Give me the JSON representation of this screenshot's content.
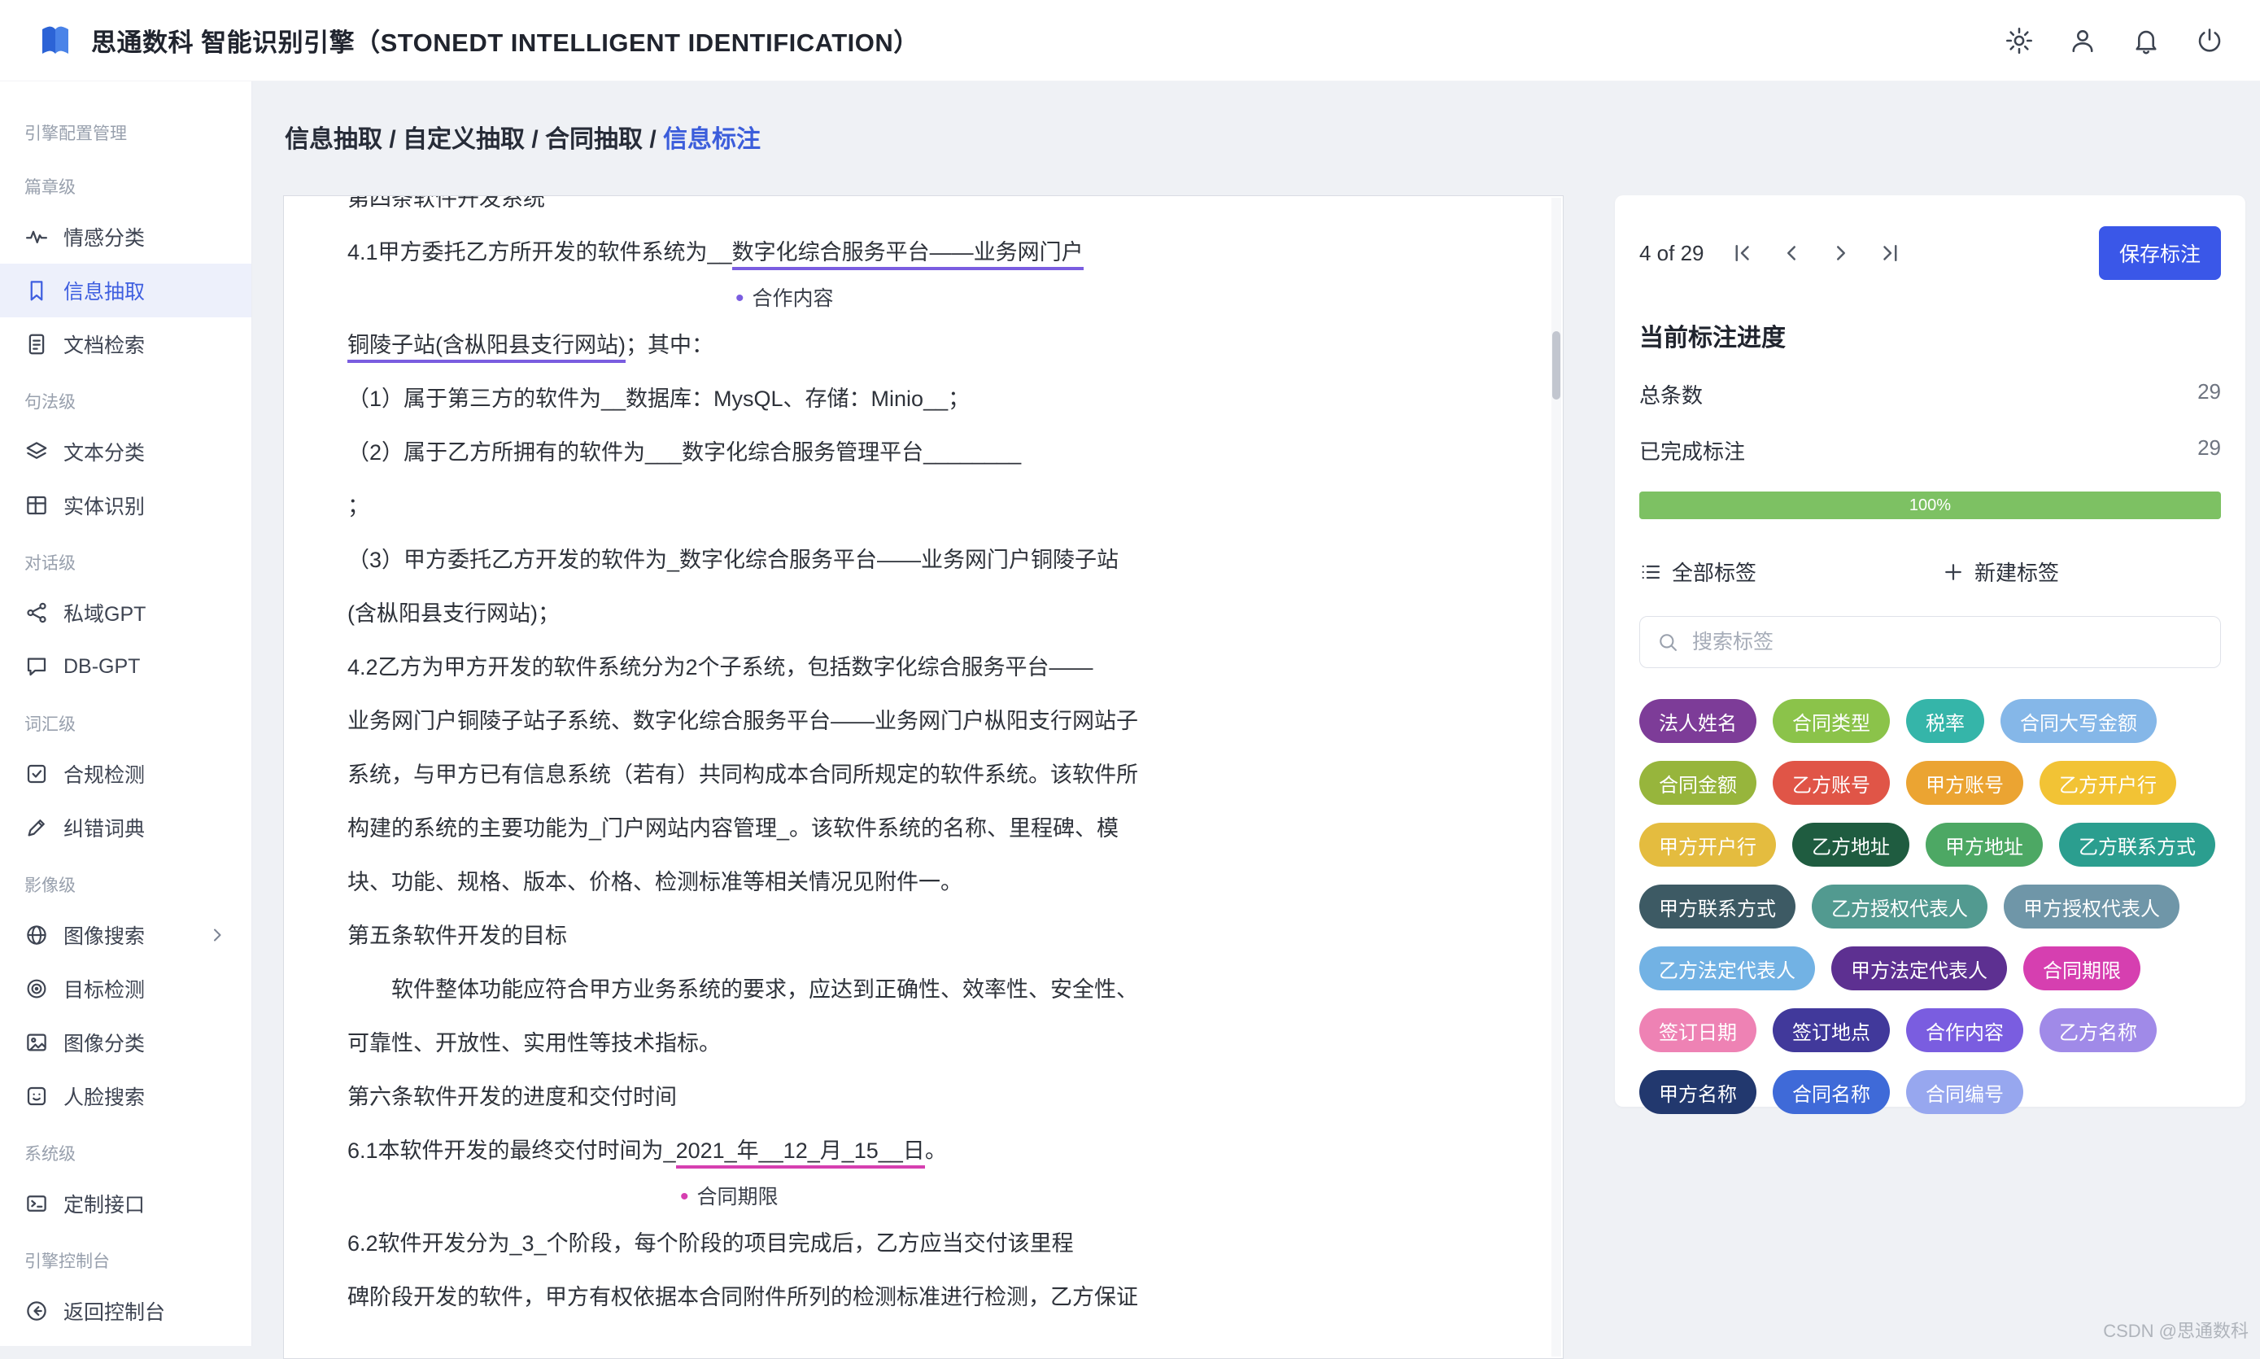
{
  "header": {
    "title": "思通数科 智能识别引擎（STONEDT INTELLIGENT IDENTIFICATION）",
    "icons": [
      {
        "id": "gear",
        "name": "gear-icon"
      },
      {
        "id": "user",
        "name": "user-icon"
      },
      {
        "id": "bell",
        "name": "bell-icon"
      },
      {
        "id": "power",
        "name": "power-icon"
      }
    ]
  },
  "sidebar": {
    "sections": [
      {
        "label": "引擎配置管理",
        "items": []
      },
      {
        "label": "篇章级",
        "items": [
          {
            "id": "sentiment",
            "label": "情感分类",
            "icon": "pulse"
          },
          {
            "id": "info-extract",
            "label": "信息抽取",
            "icon": "bookmark",
            "active": true
          },
          {
            "id": "doc-search",
            "label": "文档检索",
            "icon": "doc"
          }
        ]
      },
      {
        "label": "句法级",
        "items": [
          {
            "id": "text-classify",
            "label": "文本分类",
            "icon": "layers"
          },
          {
            "id": "entity-recognition",
            "label": "实体识别",
            "icon": "grid"
          }
        ]
      },
      {
        "label": "对话级",
        "items": [
          {
            "id": "private-gpt",
            "label": "私域GPT",
            "icon": "network"
          },
          {
            "id": "db-gpt",
            "label": "DB-GPT",
            "icon": "chat"
          }
        ]
      },
      {
        "label": "词汇级",
        "items": [
          {
            "id": "compliance-check",
            "label": "合规检测",
            "icon": "checkbox"
          },
          {
            "id": "correction-dict",
            "label": "纠错词典",
            "icon": "pencil"
          }
        ]
      },
      {
        "label": "影像级",
        "items": [
          {
            "id": "image-search",
            "label": "图像搜索",
            "icon": "globe",
            "chevron": true
          },
          {
            "id": "object-detection",
            "label": "目标检测",
            "icon": "target"
          },
          {
            "id": "image-classify",
            "label": "图像分类",
            "icon": "image"
          },
          {
            "id": "face-search",
            "label": "人脸搜索",
            "icon": "face"
          }
        ]
      },
      {
        "label": "系统级",
        "items": [
          {
            "id": "custom-api",
            "label": "定制接口",
            "icon": "api"
          }
        ]
      },
      {
        "label": "引擎控制台",
        "items": [
          {
            "id": "back-console",
            "label": "返回控制台",
            "icon": "back"
          }
        ]
      }
    ]
  },
  "breadcrumb": {
    "items": [
      "信息抽取",
      "自定义抽取",
      "合同抽取"
    ],
    "current": "信息标注",
    "separator": "/"
  },
  "document": {
    "marks": {
      "coop": {
        "label": "合作内容",
        "color": "#7a5de0"
      },
      "term": {
        "label": "合同期限",
        "color": "#d63fb0"
      }
    },
    "lines": [
      {
        "type": "clipped",
        "segs": [
          {
            "t": "第四条软件开发系统"
          }
        ]
      },
      {
        "type": "text",
        "segs": [
          {
            "t": "4.1甲方委托乙方所开发的软件系统为__"
          },
          {
            "t": "数字化综合服务平台——业务网门户",
            "mark": "coop"
          }
        ]
      },
      {
        "type": "label",
        "mark": "coop",
        "indent": 477
      },
      {
        "type": "text",
        "segs": [
          {
            "t": "铜陵子站(含枞阳县支行网站)",
            "mark": "coop"
          },
          {
            "t": "；其中："
          }
        ]
      },
      {
        "type": "text",
        "segs": [
          {
            "t": "（1）属于第三方的软件为__数据库：MysQL、存储：Minio__；"
          }
        ]
      },
      {
        "type": "text",
        "segs": [
          {
            "t": "（2）属于乙方所拥有的软件为___数字化综合服务管理平台________"
          }
        ]
      },
      {
        "type": "text",
        "segs": [
          {
            "t": "；"
          }
        ]
      },
      {
        "type": "text",
        "segs": [
          {
            "t": "（3）甲方委托乙方开发的软件为_数字化综合服务平台——业务网门户铜陵子站"
          }
        ]
      },
      {
        "type": "text",
        "segs": [
          {
            "t": "(含枞阳县支行网站)；"
          }
        ]
      },
      {
        "type": "text",
        "segs": [
          {
            "t": "4.2乙方为甲方开发的软件系统分为2个子系统，包括数字化综合服务平台——"
          }
        ]
      },
      {
        "type": "text",
        "segs": [
          {
            "t": "业务网门户铜陵子站子系统、数字化综合服务平台——业务网门户枞阳支行网站子"
          }
        ]
      },
      {
        "type": "text",
        "segs": [
          {
            "t": "系统，与甲方已有信息系统（若有）共同构成本合同所规定的软件系统。该软件所"
          }
        ]
      },
      {
        "type": "text",
        "segs": [
          {
            "t": "构建的系统的主要功能为_门户网站内容管理_。该软件系统的名称、里程碑、模"
          }
        ]
      },
      {
        "type": "text",
        "segs": [
          {
            "t": "块、功能、规格、版本、价格、检测标准等相关情况见附件一。"
          }
        ]
      },
      {
        "type": "text",
        "segs": [
          {
            "t": "第五条软件开发的目标"
          }
        ]
      },
      {
        "type": "text",
        "indent": 54,
        "segs": [
          {
            "t": "软件整体功能应符合甲方业务系统的要求，应达到正确性、效率性、安全性、"
          }
        ]
      },
      {
        "type": "text",
        "segs": [
          {
            "t": "可靠性、开放性、实用性等技术指标。"
          }
        ]
      },
      {
        "type": "text",
        "segs": [
          {
            "t": "第六条软件开发的进度和交付时间"
          }
        ]
      },
      {
        "type": "text",
        "segs": [
          {
            "t": "6.1本软件开发的最终交付时间为_"
          },
          {
            "t": "2021_年__12_月_15__日",
            "mark": "term"
          },
          {
            "t": "。"
          }
        ]
      },
      {
        "type": "label",
        "mark": "term",
        "indent": 409
      },
      {
        "type": "text",
        "segs": [
          {
            "t": "6.2软件开发分为_3_个阶段，每个阶段的项目完成后，乙方应当交付该里程"
          }
        ]
      },
      {
        "type": "text",
        "segs": [
          {
            "t": "碑阶段开发的软件，甲方有权依据本合同附件所列的检测标准进行检测，乙方保证"
          }
        ]
      }
    ]
  },
  "panel": {
    "pagination": {
      "current_label": "4 of 29"
    },
    "save_label": "保存标注",
    "progress": {
      "title": "当前标注进度",
      "rows": [
        {
          "label": "总条数",
          "value": "29"
        },
        {
          "label": "已完成标注",
          "value": "29"
        }
      ],
      "percent": "100%",
      "bar_color": "#7dc163"
    },
    "tags_header": {
      "all_label": "全部标签",
      "new_label": "新建标签"
    },
    "search": {
      "placeholder": "搜索标签"
    },
    "tags": [
      {
        "label": "法人姓名",
        "color": "#7d3c98"
      },
      {
        "label": "合同类型",
        "color": "#8bc34a"
      },
      {
        "label": "税率",
        "color": "#35b5a9"
      },
      {
        "label": "合同大写金额",
        "color": "#85b7e8"
      },
      {
        "label": "合同金额",
        "color": "#97b53c"
      },
      {
        "label": "乙方账号",
        "color": "#e05547"
      },
      {
        "label": "甲方账号",
        "color": "#eba432"
      },
      {
        "label": "乙方开户行",
        "color": "#f2c335"
      },
      {
        "label": "甲方开户行",
        "color": "#e4bc3f"
      },
      {
        "label": "乙方地址",
        "color": "#1f5c40"
      },
      {
        "label": "甲方地址",
        "color": "#4da864"
      },
      {
        "label": "乙方联系方式",
        "color": "#2b9e8f"
      },
      {
        "label": "甲方联系方式",
        "color": "#3d5a64"
      },
      {
        "label": "乙方授权代表人",
        "color": "#529a90"
      },
      {
        "label": "甲方授权代表人",
        "color": "#6f96a8"
      },
      {
        "label": "乙方法定代表人",
        "color": "#72b2e4"
      },
      {
        "label": "甲方法定代表人",
        "color": "#5d3091"
      },
      {
        "label": "合同期限",
        "color": "#d63fb0"
      },
      {
        "label": "签订日期",
        "color": "#ee82b4"
      },
      {
        "label": "签订地点",
        "color": "#41399b"
      },
      {
        "label": "合作内容",
        "color": "#7a5de0"
      },
      {
        "label": "乙方名称",
        "color": "#a08ae8"
      },
      {
        "label": "甲方名称",
        "color": "#22386e"
      },
      {
        "label": "合同名称",
        "color": "#3f6ad8"
      },
      {
        "label": "合同编号",
        "color": "#97a7ef"
      }
    ]
  },
  "watermark": "CSDN @思通数科"
}
